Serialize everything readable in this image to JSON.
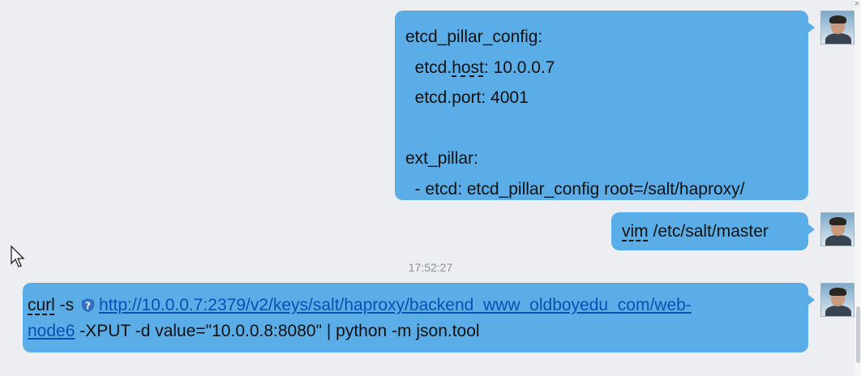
{
  "messages": [
    {
      "lines": [
        "etcd_pillar_config:",
        "  etcd.host: 10.0.0.7",
        "  etcd.port: 4001",
        "",
        "ext_pillar:",
        "  - etcd: etcd_pillar_config root=/salt/haproxy/"
      ]
    },
    {
      "text_word": "vim",
      "text_rest": " /etc/salt/master"
    },
    {
      "cmd_word": "curl",
      "cmd_flag": " -s ",
      "url_part1": "http://10.0.0.7:2379/v2/keys/salt/haproxy/backend_www_oldboyedu_com/web-",
      "url_part2": "node6",
      "cmd_rest": " -XPUT -d value=\"10.0.0.8:8080\" | python -m json.tool"
    }
  ],
  "b1": {
    "l2_pre": "  etcd.",
    "l2_word": "host",
    "l2_post": ": 10.0.0.7"
  },
  "timestamp": "17:52:27",
  "colors": {
    "bubble": "#5aade6",
    "link": "#0a4fb3",
    "background": "#eceef1"
  },
  "icons": {
    "avatar": "user-avatar",
    "help": "question-shield-icon",
    "cursor": "mouse-pointer-icon"
  }
}
